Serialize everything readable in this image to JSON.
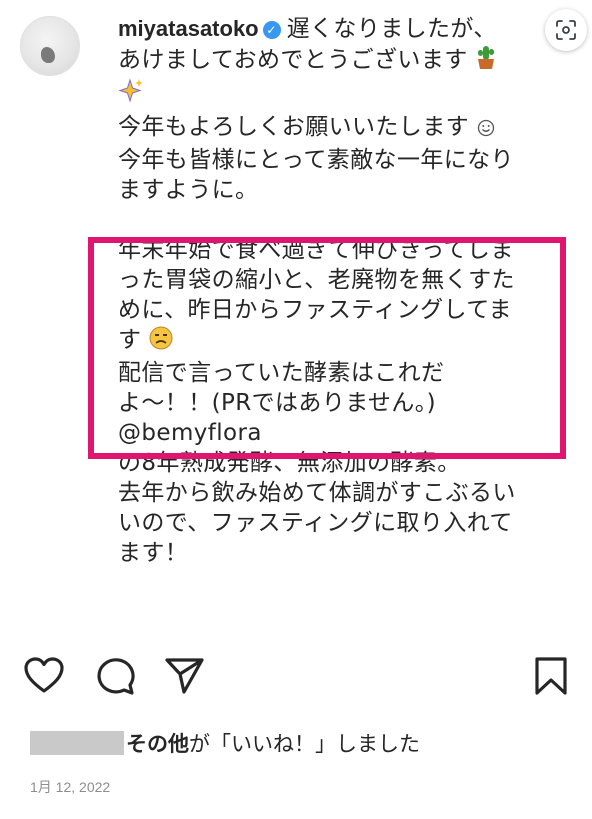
{
  "post": {
    "username": "miyatasatoko",
    "lines": [
      "遅くなりましたが、",
      "あけましておめでとうございます",
      "今年もよろしくお願いいたします",
      "今年も皆様にとって素敵な一年になり",
      "ますように。",
      "年末年始で食べ過ぎて伸びきってしま",
      "った胃袋の縮小と、老廃物を無くすた",
      "めに、昨日からファスティングしてま",
      "す",
      "配信で言っていた酵素はこれだ",
      "よ〜！！(PRではありません。)",
      "@bemyflora",
      "の8年熟成発酵、無添加の酵素。",
      "去年から飲み始めて体調がすこぶるい",
      "いので、ファスティングに取り入れて",
      "ます！"
    ]
  },
  "likes": {
    "others": "その他",
    "suffix": "が「いいね！」しました"
  },
  "date": "1月 12, 2022",
  "colors": {
    "highlight_border": "#e0156f",
    "verified": "#3897f0"
  },
  "icons": [
    "verified-icon",
    "potted-cactus-icon",
    "sparkles-icon",
    "smiley-icon",
    "sad-face-icon",
    "heart-icon",
    "comment-icon",
    "share-icon",
    "bookmark-icon",
    "lens-icon"
  ]
}
